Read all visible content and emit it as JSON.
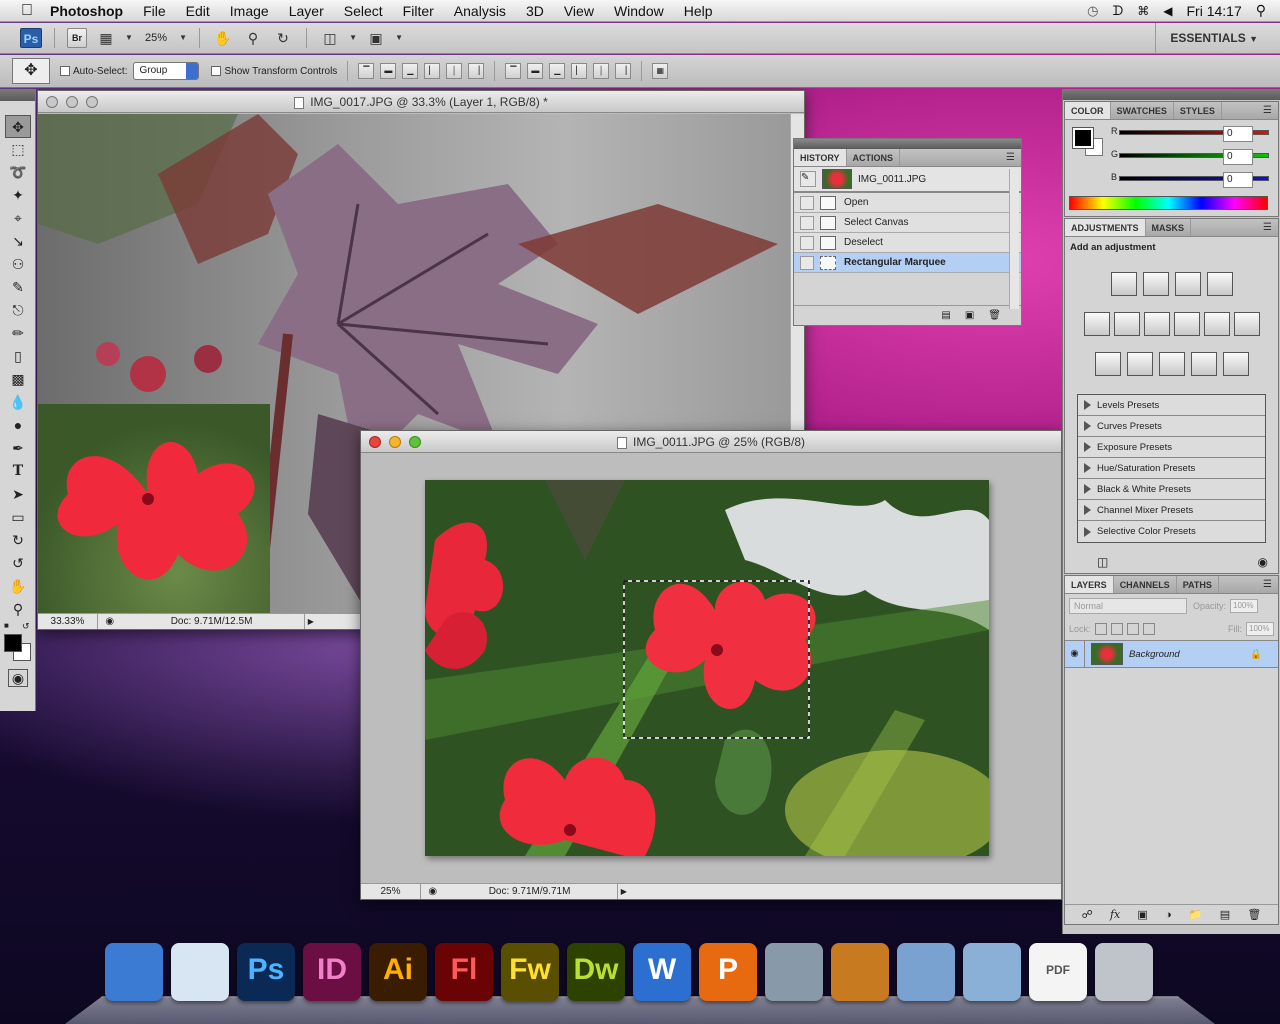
{
  "menubar": {
    "app_name": "Photoshop",
    "items": [
      "File",
      "Edit",
      "Image",
      "Layer",
      "Select",
      "Filter",
      "Analysis",
      "3D",
      "View",
      "Window",
      "Help"
    ],
    "clock": "Fri 14:17"
  },
  "appbar": {
    "ps_label": "Ps",
    "br_label": "Br",
    "zoom": "25%",
    "workspace": "ESSENTIALS"
  },
  "options": {
    "auto_select_label": "Auto-Select:",
    "auto_select_value": "Group",
    "transform_label": "Show Transform Controls"
  },
  "doc1": {
    "title": "IMG_0017.JPG @ 33.3% (Layer 1, RGB/8) *",
    "zoom": "33.33%",
    "doc_info": "Doc: 9.71M/12.5M"
  },
  "doc2": {
    "title": "IMG_0011.JPG @ 25% (RGB/8)",
    "zoom": "25%",
    "doc_info": "Doc: 9.71M/9.71M"
  },
  "history": {
    "tabs": [
      "HISTORY",
      "ACTIONS"
    ],
    "snapshot": "IMG_0011.JPG",
    "steps": [
      "Open",
      "Select Canvas",
      "Deselect",
      "Rectangular Marquee"
    ],
    "active_index": 3
  },
  "color_panel": {
    "tabs": [
      "COLOR",
      "SWATCHES",
      "STYLES"
    ],
    "channels": [
      {
        "label": "R",
        "value": "0",
        "color": "#e01010"
      },
      {
        "label": "G",
        "value": "0",
        "color": "#10c010"
      },
      {
        "label": "B",
        "value": "0",
        "color": "#1010e0"
      }
    ]
  },
  "adjustments": {
    "tabs": [
      "ADJUSTMENTS",
      "MASKS"
    ],
    "heading": "Add an adjustment",
    "presets": [
      "Levels Presets",
      "Curves Presets",
      "Exposure Presets",
      "Hue/Saturation Presets",
      "Black & White Presets",
      "Channel Mixer Presets",
      "Selective Color Presets"
    ]
  },
  "layers": {
    "tabs": [
      "LAYERS",
      "CHANNELS",
      "PATHS"
    ],
    "blend_mode": "Normal",
    "opacity_label": "Opacity:",
    "opacity_value": "100%",
    "lock_label": "Lock:",
    "fill_label": "Fill:",
    "fill_value": "100%",
    "layer_name": "Background"
  },
  "dock": {
    "apps": [
      {
        "label": "",
        "bg": "#3b7bd4",
        "fg": "#fff",
        "icon": "finder-icon"
      },
      {
        "label": "",
        "bg": "#d8e6f4",
        "fg": "#333",
        "icon": "safari-icon"
      },
      {
        "label": "Ps",
        "bg": "#0a2a55",
        "fg": "#4fb4ff",
        "icon": "photoshop-icon"
      },
      {
        "label": "ID",
        "bg": "#6a0e44",
        "fg": "#f080c8",
        "icon": "indesign-icon"
      },
      {
        "label": "Ai",
        "bg": "#3a1c00",
        "fg": "#ffb000",
        "icon": "illustrator-icon"
      },
      {
        "label": "Fl",
        "bg": "#6a0404",
        "fg": "#ff5a5a",
        "icon": "flash-icon"
      },
      {
        "label": "Fw",
        "bg": "#5a4e00",
        "fg": "#ffe030",
        "icon": "fireworks-icon"
      },
      {
        "label": "Dw",
        "bg": "#2e4200",
        "fg": "#b8e030",
        "icon": "dreamweaver-icon"
      },
      {
        "label": "W",
        "bg": "#2d6fd0",
        "fg": "#fff",
        "icon": "word-icon"
      },
      {
        "label": "P",
        "bg": "#e86a10",
        "fg": "#fff",
        "icon": "powerpoint-icon"
      },
      {
        "label": "",
        "bg": "#8899aa",
        "fg": "#fff",
        "icon": "preview-icon"
      },
      {
        "label": "",
        "bg": "#c87a20",
        "fg": "#fff",
        "icon": "iphoto-icon"
      },
      {
        "label": "",
        "bg": "#7aa2d0",
        "fg": "#fff",
        "icon": "applications-folder-icon"
      },
      {
        "label": "",
        "bg": "#8ab0d8",
        "fg": "#fff",
        "icon": "documents-folder-icon"
      },
      {
        "label": "PDF",
        "bg": "#f4f4f4",
        "fg": "#555",
        "icon": "pdf-file-icon"
      },
      {
        "label": "",
        "bg": "#bfc4ca",
        "fg": "#333",
        "icon": "trash-icon"
      }
    ]
  }
}
